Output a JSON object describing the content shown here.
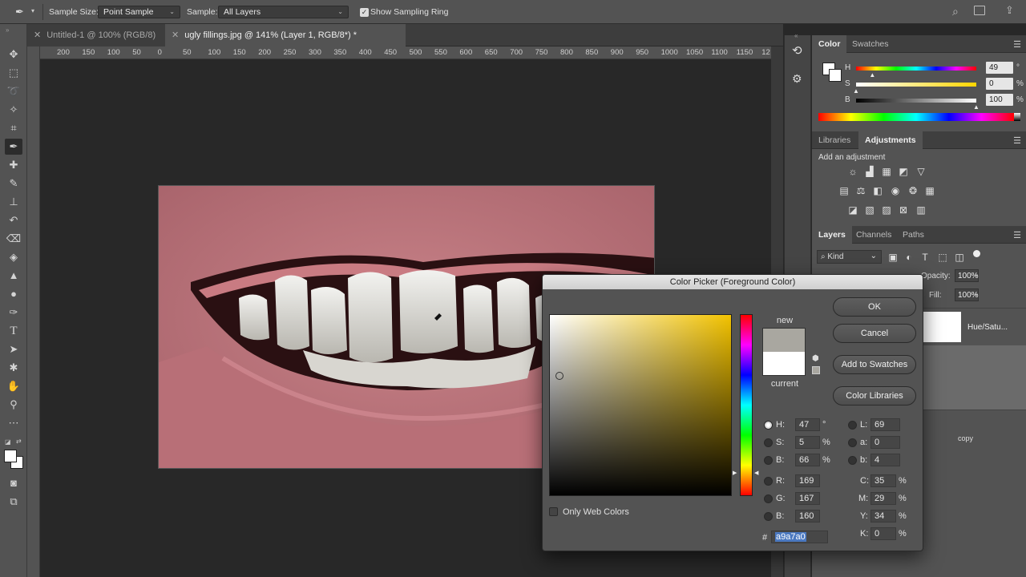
{
  "options_bar": {
    "sample_size_label": "Sample Size:",
    "sample_size_value": "Point Sample",
    "sample_label": "Sample:",
    "sample_value": "All Layers",
    "show_ring_label": "Show Sampling Ring",
    "show_ring_checked": true
  },
  "doc_tabs": [
    {
      "label": "Untitled-1 @ 100% (RGB/8)"
    },
    {
      "label": "ugly fillings.jpg @ 141% (Layer 1, RGB/8*) *"
    }
  ],
  "ruler_ticks": [
    "200",
    "150",
    "100",
    "50",
    "0",
    "50",
    "100",
    "150",
    "200",
    "250",
    "300",
    "350",
    "400",
    "450",
    "500",
    "550",
    "600",
    "650",
    "700",
    "750",
    "800",
    "850",
    "900",
    "950",
    "1000",
    "1050",
    "1100",
    "1150",
    "12"
  ],
  "color_panel": {
    "tabs": [
      "Color",
      "Swatches"
    ],
    "h_label": "H",
    "h_value": "49",
    "h_unit": "°",
    "h_pos": 0.136,
    "s_label": "S",
    "s_value": "0",
    "s_unit": "%",
    "s_pos": 0.0,
    "b_label": "B",
    "b_value": "100",
    "b_unit": "%",
    "b_pos": 1.0
  },
  "adjust_panel": {
    "tabs": [
      "Libraries",
      "Adjustments"
    ],
    "add_label": "Add an adjustment"
  },
  "layers_panel": {
    "tabs": [
      "Layers",
      "Channels",
      "Paths"
    ],
    "kind_label": "Kind",
    "opacity_label": "Opacity:",
    "opacity_value": "100%",
    "fill_label": "Fill:",
    "fill_value": "100%",
    "layer1_name": "Hue/Satu...",
    "layer2_name": "copy"
  },
  "picker": {
    "title": "Color Picker (Foreground Color)",
    "new_label": "new",
    "current_label": "current",
    "new_color": "#a9a7a0",
    "current_color": "#ffffff",
    "ok": "OK",
    "cancel": "Cancel",
    "add_swatches": "Add to Swatches",
    "libraries": "Color Libraries",
    "only_web": "Only Web Colors",
    "H": {
      "label": "H:",
      "value": "47",
      "unit": "°"
    },
    "S": {
      "label": "S:",
      "value": "5",
      "unit": "%"
    },
    "Bv": {
      "label": "B:",
      "value": "66",
      "unit": "%"
    },
    "R": {
      "label": "R:",
      "value": "169"
    },
    "G": {
      "label": "G:",
      "value": "167"
    },
    "Bb": {
      "label": "B:",
      "value": "160"
    },
    "L": {
      "label": "L:",
      "value": "69"
    },
    "a": {
      "label": "a:",
      "value": "0"
    },
    "b": {
      "label": "b:",
      "value": "4"
    },
    "C": {
      "label": "C:",
      "value": "35",
      "unit": "%"
    },
    "M": {
      "label": "M:",
      "value": "29",
      "unit": "%"
    },
    "Y": {
      "label": "Y:",
      "value": "34",
      "unit": "%"
    },
    "K": {
      "label": "K:",
      "value": "0",
      "unit": "%"
    },
    "hash": "#",
    "hex": "a9a7a0"
  }
}
